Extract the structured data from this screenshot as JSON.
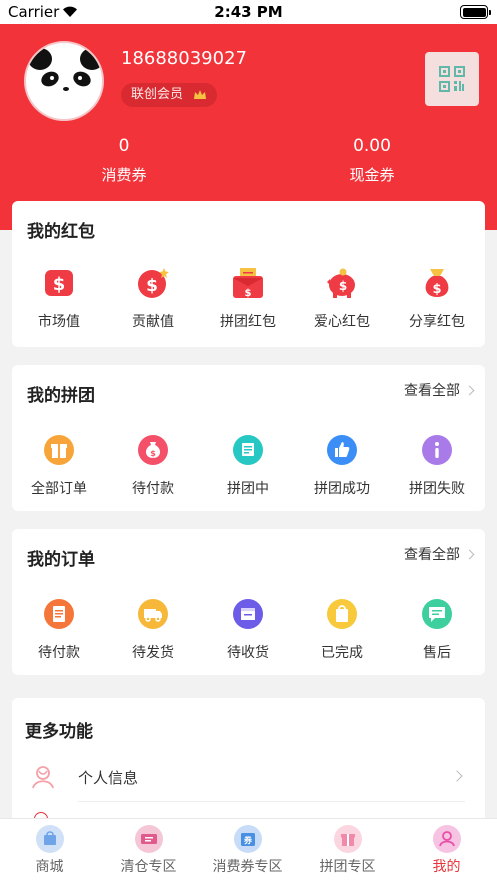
{
  "status_bar": {
    "carrier": "Carrier",
    "time": "2:43 PM"
  },
  "profile": {
    "phone": "18688039027",
    "member_label": "联创会员",
    "stats": [
      {
        "value": "0",
        "label": "消费券"
      },
      {
        "value": "0.00",
        "label": "现金券"
      }
    ]
  },
  "red_packets": {
    "title": "我的红包",
    "items": [
      {
        "label": "市场值",
        "icon": "dollar-bill-icon"
      },
      {
        "label": "贡献值",
        "icon": "dollar-coin-icon"
      },
      {
        "label": "拼团红包",
        "icon": "red-envelope-icon"
      },
      {
        "label": "爱心红包",
        "icon": "piggy-bank-icon"
      },
      {
        "label": "分享红包",
        "icon": "money-bag-icon"
      }
    ]
  },
  "group_buy": {
    "title": "我的拼团",
    "link": "查看全部",
    "items": [
      {
        "label": "全部订单",
        "icon": "gift-icon",
        "color": "#f7a53b"
      },
      {
        "label": "待付款",
        "icon": "money-bag-icon",
        "color": "#f5506a"
      },
      {
        "label": "拼团中",
        "icon": "cart-icon",
        "color": "#27c7c4"
      },
      {
        "label": "拼团成功",
        "icon": "thumbs-up-icon",
        "color": "#3a8ef5"
      },
      {
        "label": "拼团失败",
        "icon": "info-icon",
        "color": "#a97be8"
      }
    ]
  },
  "orders": {
    "title": "我的订单",
    "link": "查看全部",
    "items": [
      {
        "label": "待付款",
        "icon": "document-icon",
        "color": "#f5763a"
      },
      {
        "label": "待发货",
        "icon": "truck-icon",
        "color": "#f7b739"
      },
      {
        "label": "待收货",
        "icon": "package-icon",
        "color": "#6c5ce7"
      },
      {
        "label": "已完成",
        "icon": "bag-check-icon",
        "color": "#f7c93b"
      },
      {
        "label": "售后",
        "icon": "chat-icon",
        "color": "#3ecf9f"
      }
    ]
  },
  "more": {
    "title": "更多功能",
    "rows": [
      {
        "label": "个人信息",
        "icon": "person-icon"
      }
    ]
  },
  "tabbar": {
    "tabs": [
      {
        "label": "商城",
        "icon": "shop-icon",
        "color": "#6fa4e8"
      },
      {
        "label": "清仓专区",
        "icon": "ticket-icon",
        "color": "#e05a8e"
      },
      {
        "label": "消费券专区",
        "icon": "coupon-icon",
        "color": "#4a90e2"
      },
      {
        "label": "拼团专区",
        "icon": "gift-box-icon",
        "color": "#f08aa8"
      },
      {
        "label": "我的",
        "icon": "profile-icon",
        "color": "#e84fa8"
      }
    ],
    "active": "我的"
  }
}
